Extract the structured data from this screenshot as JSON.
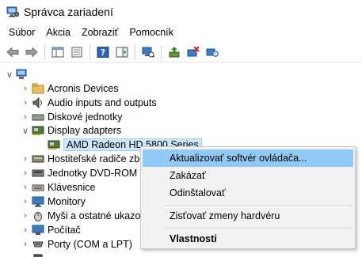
{
  "window": {
    "title": "Správca zariadení",
    "icon": "device-manager-icon"
  },
  "menu": [
    "Súbor",
    "Akcia",
    "Zobraziť",
    "Pomocník"
  ],
  "toolbar": {
    "icons": [
      "back-icon",
      "forward-icon",
      "show-hide-console-tree-icon",
      "properties-icon",
      "help-icon",
      "action-pane-icon",
      "computer-icon",
      "update-driver-icon",
      "uninstall-device-icon",
      "scan-hardware-icon"
    ]
  },
  "tree": {
    "root": {
      "icon": "computer-icon",
      "expanded": true
    },
    "items": [
      {
        "label": "Acronis Devices",
        "icon": "folder-icon",
        "expanded": false
      },
      {
        "label": "Audio inputs and outputs",
        "icon": "speaker-icon",
        "expanded": false
      },
      {
        "label": "Diskové jednotky",
        "icon": "disk-drive-icon",
        "expanded": false
      },
      {
        "label": "Display adapters",
        "icon": "display-adapter-icon",
        "expanded": true
      },
      {
        "label": "AMD Radeon HD 5800 Series",
        "icon": "display-adapter-icon",
        "child": true,
        "selected": true
      },
      {
        "label": "Hostiteľské radiče zbe",
        "icon": "ide-controller-icon",
        "expanded": false
      },
      {
        "label": "Jednotky DVD-ROM a",
        "icon": "dvd-drive-icon",
        "expanded": false
      },
      {
        "label": "Klávesnice",
        "icon": "keyboard-icon",
        "expanded": false
      },
      {
        "label": "Monitory",
        "icon": "monitor-icon",
        "expanded": false
      },
      {
        "label": "Myši a ostatné ukazo",
        "icon": "mouse-icon",
        "expanded": false
      },
      {
        "label": "Počítač",
        "icon": "computer-icon",
        "expanded": false
      },
      {
        "label": "Porty (COM a LPT)",
        "icon": "port-icon",
        "expanded": false
      },
      {
        "label": "",
        "icon": "processor-icon",
        "expanded": false
      }
    ]
  },
  "context_menu": {
    "items": [
      {
        "label": "Aktualizovať softvér ovládača...",
        "highlight": true
      },
      {
        "label": "Zakázať"
      },
      {
        "label": "Odinštalovať"
      },
      {
        "separator": true
      },
      {
        "label": "Zisťovať zmeny hardvéru"
      },
      {
        "separator": true
      },
      {
        "label": "Vlastnosti",
        "bold": true
      }
    ]
  },
  "colors": {
    "selection_bg": "#cce8ff",
    "menu_highlight": "#91c9f7",
    "menu_bg": "#f2f2f2"
  }
}
